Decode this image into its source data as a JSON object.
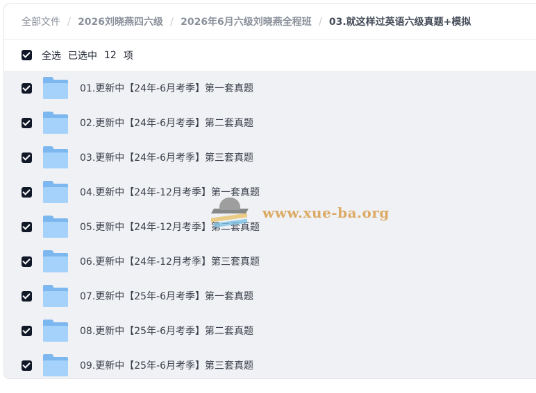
{
  "breadcrumb": {
    "items": [
      "全部文件",
      "2026刘晓燕四六级",
      "2026年6月六级刘晓燕全程班",
      "03.就这样过英语六级真题+模拟"
    ]
  },
  "selection": {
    "select_all_label": "全选",
    "selected_label": "已选中",
    "count": "12",
    "unit": "项"
  },
  "files": [
    {
      "name": "01.更新中【24年-6月考季】第一套真题",
      "checked": true
    },
    {
      "name": "02.更新中【24年-6月考季】第二套真题",
      "checked": true
    },
    {
      "name": "03.更新中【24年-6月考季】第三套真题",
      "checked": true
    },
    {
      "name": "04.更新中【24年-12月考季】第一套真题",
      "checked": true
    },
    {
      "name": "05.更新中【24年-12月考季】第二套真题",
      "checked": true
    },
    {
      "name": "06.更新中【24年-12月考季】第三套真题",
      "checked": true
    },
    {
      "name": "07.更新中【25年-6月考季】第一套真题",
      "checked": true
    },
    {
      "name": "08.更新中【25年-6月考季】第二套真题",
      "checked": true
    },
    {
      "name": "09.更新中【25年-6月考季】第三套真题",
      "checked": true
    }
  ],
  "icons": {
    "checkbox": "checkbox-checked-icon",
    "folder": "folder-icon",
    "separator": "/"
  },
  "watermark": {
    "text": "www.xue-ba.org"
  },
  "colors": {
    "checkbox": "#111827",
    "folder_front": "#a5d2fa",
    "folder_back": "#7cb7ef",
    "list_background": "#f0f1f4"
  }
}
